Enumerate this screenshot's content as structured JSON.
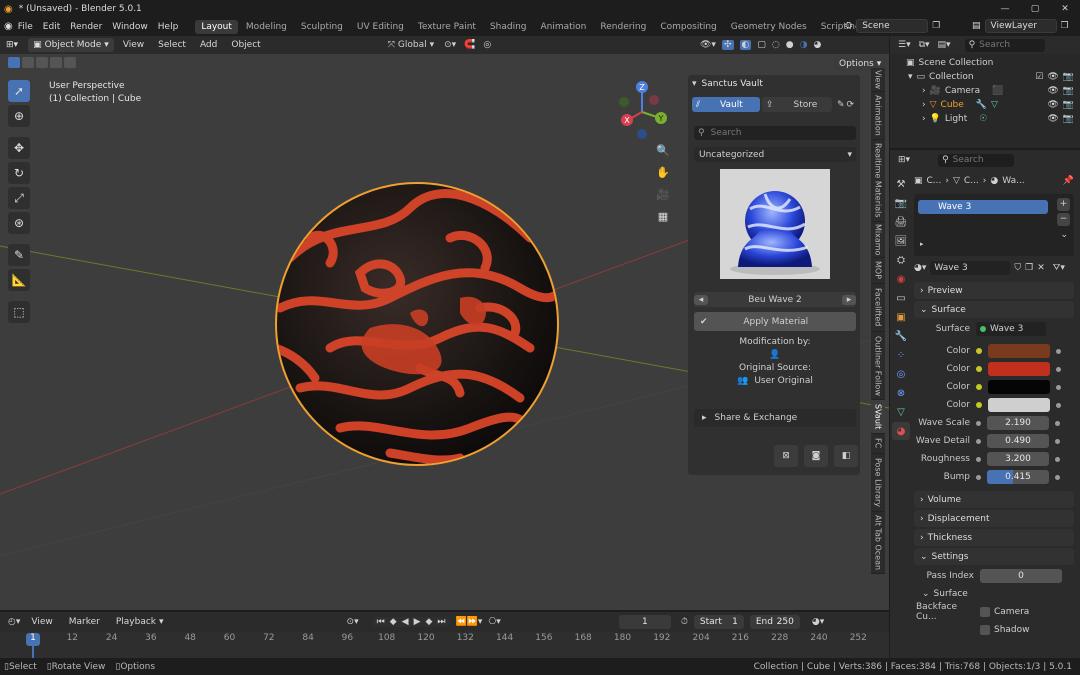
{
  "window": {
    "title": "* (Unsaved) - Blender 5.0.1"
  },
  "menu": [
    "File",
    "Edit",
    "Render",
    "Window",
    "Help"
  ],
  "workspaces": [
    "Layout",
    "Modeling",
    "Sculpting",
    "UV Editing",
    "Texture Paint",
    "Shading",
    "Animation",
    "Rendering",
    "Compositing",
    "Geometry Nodes",
    "Scripting"
  ],
  "active_workspace": "Layout",
  "scene": {
    "name": "Scene",
    "view_layer": "ViewLayer"
  },
  "viewport": {
    "mode": "Object Mode",
    "menus": [
      "View",
      "Select",
      "Add",
      "Object"
    ],
    "orientation": "Global",
    "options_label": "Options",
    "overlay_line1": "User Perspective",
    "overlay_line2": "(1) Collection | Cube",
    "axis": {
      "x": "X",
      "y": "Y",
      "z": "Z"
    }
  },
  "side_tabs": [
    "View",
    "Animation",
    "Realtime Materials",
    "Mixamo",
    "MOP",
    "Facelifted",
    "Outliner Follow",
    "SVault",
    "FC",
    "Pose Library",
    "Alt Tab Ocean"
  ],
  "active_side_tab": "SVault",
  "vault": {
    "title": "Sanctus Vault",
    "tab_vault": "Vault",
    "tab_store": "Store",
    "search_placeholder": "Search",
    "category": "Uncategorized",
    "material_name": "Beu Wave 2",
    "apply_label": "Apply Material",
    "modification_label": "Modification by:",
    "source_label": "Original Source:",
    "source_value": "User Original",
    "share_label": "Share & Exchange"
  },
  "outliner": {
    "search_placeholder": "Search",
    "items": [
      {
        "label": "Scene Collection",
        "indent": 0
      },
      {
        "label": "Collection",
        "indent": 1
      },
      {
        "label": "Camera",
        "indent": 2
      },
      {
        "label": "Cube",
        "indent": 2
      },
      {
        "label": "Light",
        "indent": 2
      }
    ]
  },
  "properties": {
    "search_placeholder": "Search",
    "breadcrumb": [
      "C...",
      "C...",
      "Wa..."
    ],
    "slot": "Wave 3",
    "material": "Wave 3",
    "sections": {
      "preview": "Preview",
      "surface": "Surface",
      "volume": "Volume",
      "displacement": "Displacement",
      "thickness": "Thickness",
      "settings": "Settings",
      "surface_sub": "Surface"
    },
    "surface_label": "Surface",
    "surface_value": "Wave 3",
    "colors": [
      {
        "label": "Color",
        "hex": "#7a3a1e"
      },
      {
        "label": "Color",
        "hex": "#c0301c"
      },
      {
        "label": "Color",
        "hex": "#050505"
      },
      {
        "label": "Color",
        "hex": "#cfcfcf"
      }
    ],
    "params": [
      {
        "label": "Wave Scale",
        "value": "2.190"
      },
      {
        "label": "Wave Detail",
        "value": "0.490"
      },
      {
        "label": "Roughness",
        "value": "3.200"
      },
      {
        "label": "Bump",
        "value": "0.415",
        "fill": 0.415
      }
    ],
    "pass_index_label": "Pass Index",
    "pass_index_value": "0",
    "backface_label": "Backface Cu...",
    "camera_label": "Camera",
    "shadow_label": "Shadow"
  },
  "timeline": {
    "menus": [
      "View",
      "Marker",
      "Playback"
    ],
    "current_frame": "1",
    "start_label": "Start",
    "start_value": "1",
    "end_label": "End",
    "end_value": "250",
    "ticks": [
      "1",
      "12",
      "24",
      "36",
      "48",
      "60",
      "72",
      "84",
      "96",
      "108",
      "120",
      "132",
      "144",
      "156",
      "168",
      "180",
      "192",
      "204",
      "216",
      "228",
      "240",
      "252"
    ]
  },
  "status": {
    "select": "Select",
    "rotate": "Rotate View",
    "options": "Options",
    "stats": "Collection | Cube | Verts:386 | Faces:384 | Tris:768 | Objects:1/3 | 5.0.1"
  },
  "colors": {
    "accent": "#4772b3",
    "selected_object": "#f0a030"
  }
}
